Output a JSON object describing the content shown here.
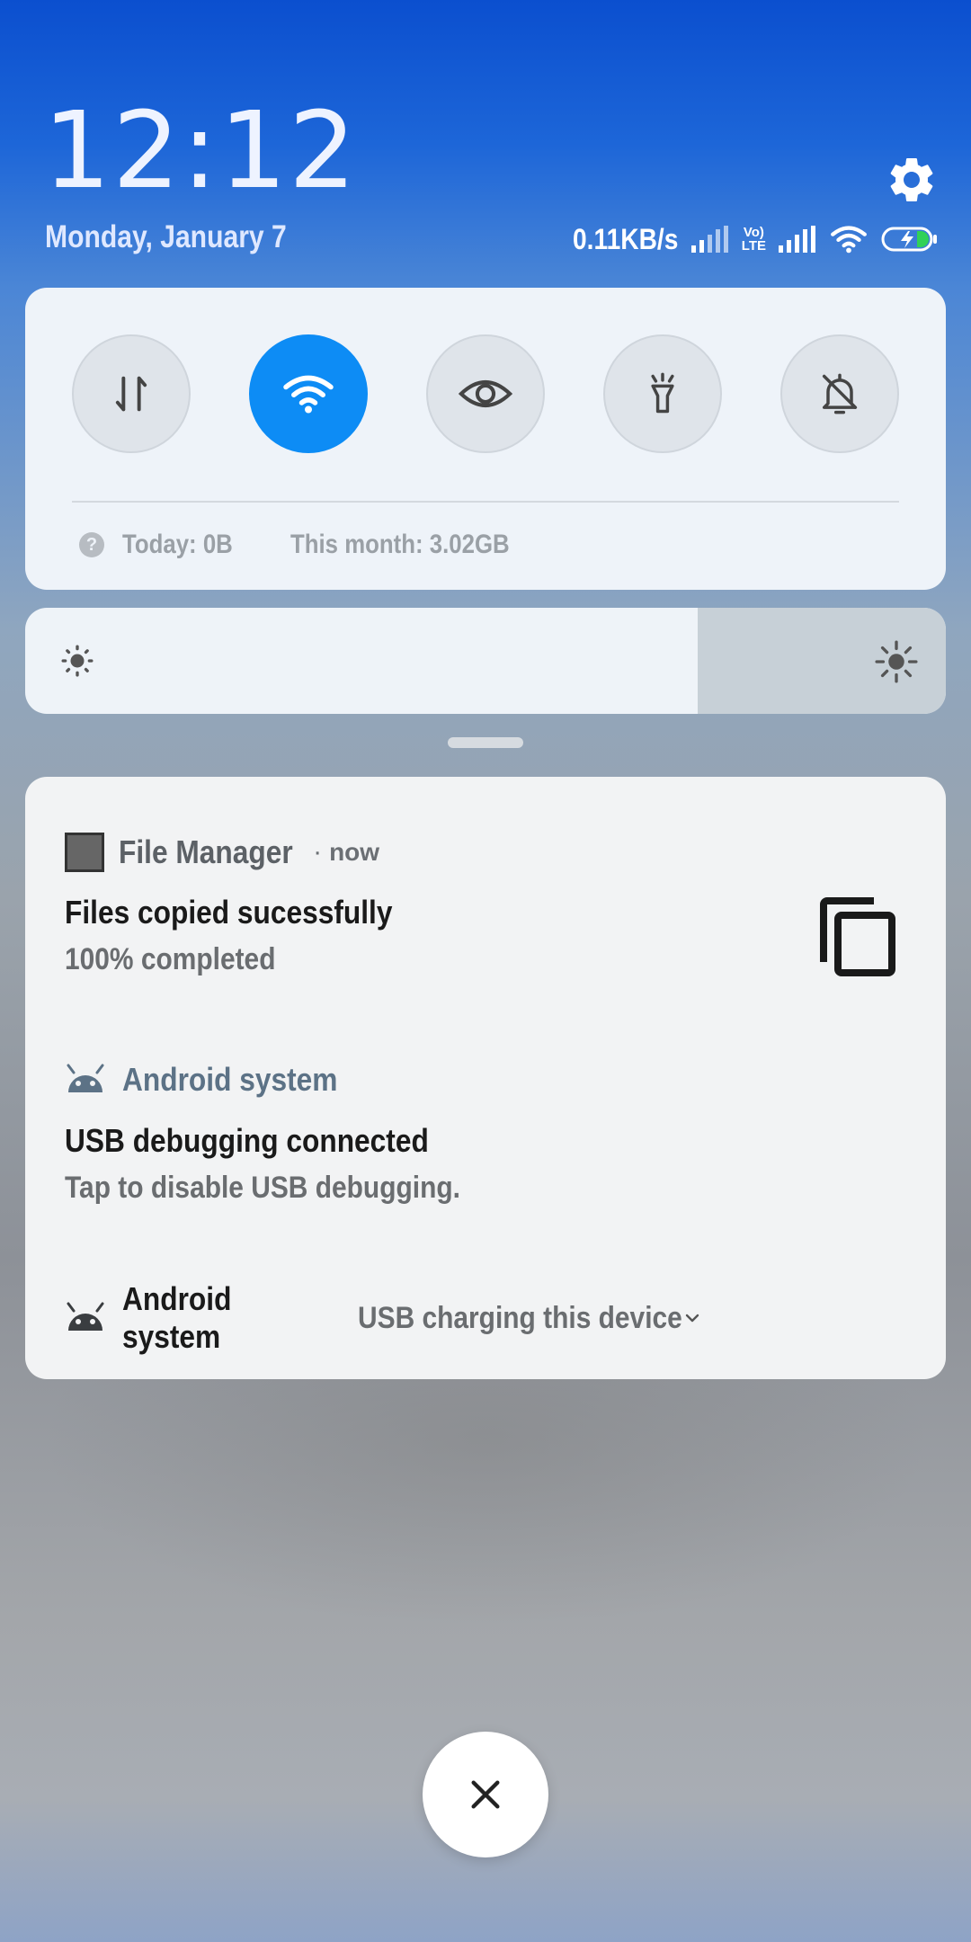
{
  "header": {
    "time": "12:12",
    "date": "Monday, January 7",
    "settings_icon": "gear-icon"
  },
  "status_bar": {
    "net_speed": "0.11KB/s",
    "volte_top": "Vo)",
    "volte_bottom": "LTE",
    "icons": [
      "signal-icon",
      "volte-icon",
      "signal-icon",
      "wifi-icon",
      "battery-charging-icon"
    ]
  },
  "quick_settings": {
    "toggles": [
      {
        "name": "mobile-data",
        "icon": "data-arrows-icon",
        "on": false
      },
      {
        "name": "wifi",
        "icon": "wifi-icon",
        "on": true
      },
      {
        "name": "reading-mode",
        "icon": "eye-icon",
        "on": false
      },
      {
        "name": "flashlight",
        "icon": "flashlight-icon",
        "on": false
      },
      {
        "name": "silent",
        "icon": "bell-off-icon",
        "on": false
      }
    ],
    "usage_today": "Today: 0B",
    "usage_month": "This month: 3.02GB",
    "accent": "#0d8cf5"
  },
  "brightness": {
    "level": 0.73
  },
  "notifications": [
    {
      "app": "File Manager",
      "time": "now",
      "title": "Files copied sucessfully",
      "text": "100% completed"
    },
    {
      "app": "Android system",
      "title": "USB debugging connected",
      "text": "Tap to disable USB debugging."
    },
    {
      "app": "Android system",
      "text": "USB charging this device"
    }
  ],
  "close_button_icon": "close-icon"
}
